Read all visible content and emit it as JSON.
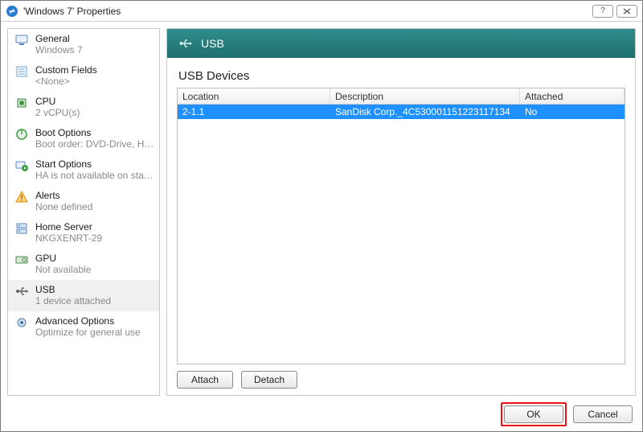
{
  "window": {
    "title": "'Windows 7' Properties"
  },
  "sidebar": {
    "items": [
      {
        "id": "general",
        "label": "General",
        "sub": "Windows 7"
      },
      {
        "id": "custom",
        "label": "Custom Fields",
        "sub": "<None>"
      },
      {
        "id": "cpu",
        "label": "CPU",
        "sub": "2 vCPU(s)"
      },
      {
        "id": "boot",
        "label": "Boot Options",
        "sub": "Boot order: DVD-Drive, Har..."
      },
      {
        "id": "start",
        "label": "Start Options",
        "sub": "HA is not available on stan..."
      },
      {
        "id": "alerts",
        "label": "Alerts",
        "sub": "None defined"
      },
      {
        "id": "home",
        "label": "Home Server",
        "sub": "NKGXENRT-29"
      },
      {
        "id": "gpu",
        "label": "GPU",
        "sub": "Not available"
      },
      {
        "id": "usb",
        "label": "USB",
        "sub": "1 device attached"
      },
      {
        "id": "advanced",
        "label": "Advanced Options",
        "sub": "Optimize for general use"
      }
    ]
  },
  "panel": {
    "header": "USB",
    "section_title": "USB Devices",
    "columns": {
      "location": "Location",
      "description": "Description",
      "attached": "Attached"
    },
    "rows": [
      {
        "location": "2-1.1",
        "description": "SanDisk Corp._4C530001151223117134",
        "attached": "No"
      }
    ],
    "attach_label": "Attach",
    "detach_label": "Detach"
  },
  "buttons": {
    "ok": "OK",
    "cancel": "Cancel"
  }
}
